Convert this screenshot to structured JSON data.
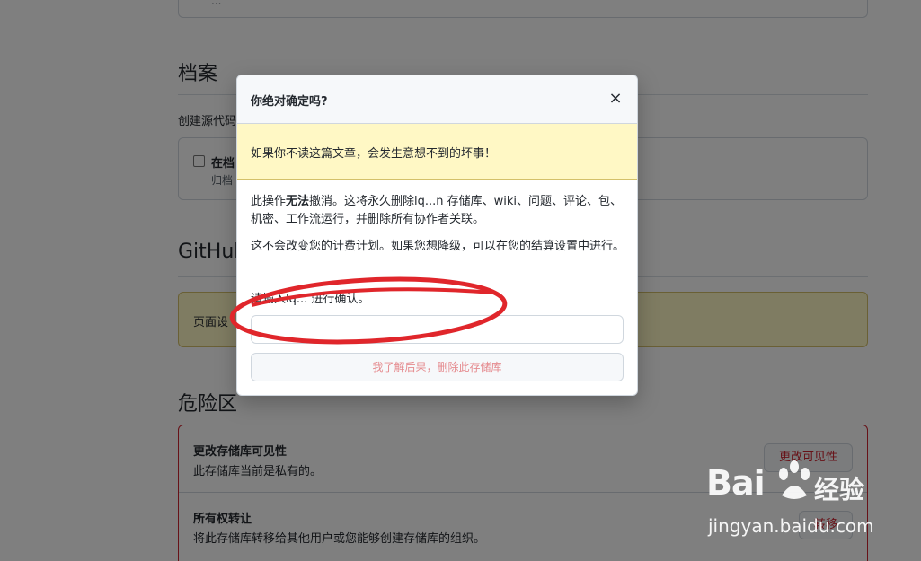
{
  "background": {
    "top_box_text": "...",
    "archive": {
      "heading": "档案",
      "description": "创建源代码",
      "checkbox_label": "在档",
      "checkbox_sub": "归档"
    },
    "github_pages": {
      "heading": "GitHub",
      "flash_text": "页面设"
    },
    "danger_zone": {
      "heading": "危险区",
      "rows": [
        {
          "title": "更改存储库可见性",
          "description": "此存储库当前是私有的。",
          "button": "更改可见性"
        },
        {
          "title": "所有权转让",
          "description": "将此存储库转移给其他用户或您能够创建存储库的组织。",
          "button": "转移"
        }
      ]
    }
  },
  "modal": {
    "title": "你绝对确定吗?",
    "close_symbol": "×",
    "warning": "如果你不读这篇文章，会发生意想不到的坏事！",
    "body_p1_prefix": "此操作",
    "body_p1_bold": "无法",
    "body_p1_suffix": "撤消。这将永久删除lq...n 存储库、wiki、问题、评论、包、机密、工作流运行，并删除所有协作者关联。",
    "body_p2": "这不会改变您的计费计划。如果您想降级，可以在您的结算设置中进行。",
    "confirm_label": "请输入lq... 进行确认。",
    "input_value": "",
    "confirm_button": "我了解后果，删除此存储库"
  },
  "watermark": {
    "brand": "Bai",
    "brand_cn": "经验",
    "url": "jingyan.baidu.com"
  },
  "colors": {
    "annotation": "#e0262b",
    "danger": "#cf222e",
    "warning_bg": "#fff8c5"
  }
}
